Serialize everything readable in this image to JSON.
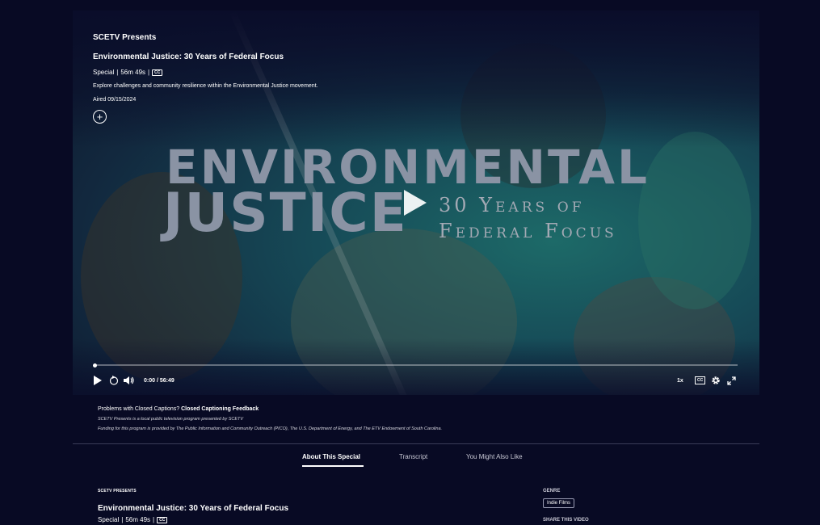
{
  "player": {
    "show_name": "SCETV Presents",
    "episode_title": "Environmental Justice: 30 Years of Federal Focus",
    "type": "Special",
    "duration": "56m 49s",
    "cc_badge": "CC",
    "description": "Explore challenges and community resilience within the Environmental Justice movement.",
    "aired": "Aired 09/15/2024",
    "add_icon": "plus-circle-icon",
    "poster": {
      "line1": "ENVIRONMENTAL",
      "line2": "JUSTICE",
      "line3": "30 Years of",
      "line4": "Federal Focus"
    },
    "progress_fraction": 0,
    "time_current": "0:00",
    "time_separator": "/",
    "time_total": "56:49",
    "speed": "1x",
    "cc_label": "CC"
  },
  "notes": {
    "cc_problem": "Problems with Closed Captions?",
    "cc_feedback_link": "Closed Captioning Feedback",
    "presenter_note": "SCETV Presents is a local public television program presented by SCETV",
    "funding_note": "Funding for this program is provided by The Public Information and Community Outreach (PICO), The U.S. Department of Energy, and The ETV Endowment of South Carolina."
  },
  "tabs": [
    {
      "label": "About This Special",
      "active": true
    },
    {
      "label": "Transcript",
      "active": false
    },
    {
      "label": "You Might Also Like",
      "active": false
    }
  ],
  "about": {
    "kicker": "SCETV PRESENTS",
    "title": "Environmental Justice: 30 Years of Federal Focus",
    "type": "Special",
    "duration": "56m 49s",
    "cc_badge": "CC"
  },
  "side": {
    "genre_heading": "GENRE",
    "genre": "Indie Films",
    "share_heading": "SHARE THIS VIDEO"
  },
  "colors": {
    "background": "#080a24",
    "accent": "#ffffff"
  }
}
